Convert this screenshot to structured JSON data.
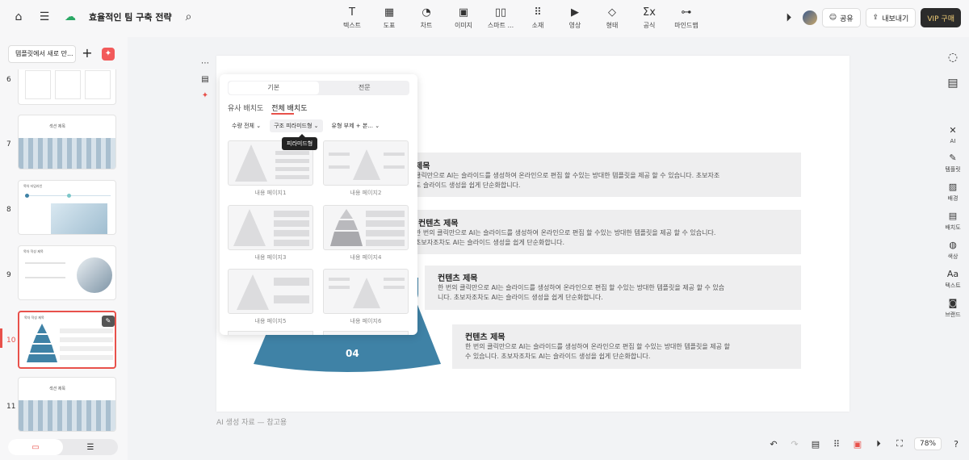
{
  "header": {
    "doc_title": "효율적인 팀 구축 전략",
    "tools": [
      {
        "icon": "text-icon",
        "glyph": "T",
        "label": "텍스트"
      },
      {
        "icon": "table-icon",
        "glyph": "▦",
        "label": "도표"
      },
      {
        "icon": "chart-icon",
        "glyph": "◔",
        "label": "차트"
      },
      {
        "icon": "image-icon",
        "glyph": "▣",
        "label": "이미지"
      },
      {
        "icon": "smart-icon",
        "glyph": "▯▯",
        "label": "스마트 ..."
      },
      {
        "icon": "elements-icon",
        "glyph": "⠿",
        "label": "소재"
      },
      {
        "icon": "video-icon",
        "glyph": "▶",
        "label": "영상"
      },
      {
        "icon": "shape-icon",
        "glyph": "◇",
        "label": "형태"
      },
      {
        "icon": "formula-icon",
        "glyph": "Σx",
        "label": "공식"
      },
      {
        "icon": "mindmap-icon",
        "glyph": "⊶",
        "label": "마인드맵"
      }
    ],
    "share_label": "공유",
    "export_label": "내보내기",
    "vip_label": "VIP 구매"
  },
  "sidebar": {
    "template_btn": "템플릿에서 새로 만...",
    "thumbnails": [
      {
        "num": "6"
      },
      {
        "num": "7",
        "title": "섹션 제목"
      },
      {
        "num": "8",
        "title": "목차 타임라인"
      },
      {
        "num": "9",
        "title": "목차 작성 제목"
      },
      {
        "num": "10",
        "title": "목차 작성 제목"
      },
      {
        "num": "11",
        "title": "섹션 제목"
      }
    ]
  },
  "slide": {
    "rows": [
      {
        "title": "제목",
        "text": "클릭만으로 AI는 슬라이드를 생성하여 온라인으로 편집 할 수있는 방대한 템플릿을 제공 할 수 있습니다. 초보자조\n도 슬라이드 생성을 쉽게 단순화합니다."
      },
      {
        "title": "컨텐츠 제목",
        "text": "한 번의 클릭만으로 AI는 슬라이드를 생성하여 온라인으로 편집 할 수있는 방대한 템플릿을 제공 할 수 있습니다.\n초보자조차도 AI는 슬라이드 생성을 쉽게 단순화합니다."
      },
      {
        "title": "컨텐츠 제목",
        "text": "한 번의 클릭만으로 AI는 슬라이드를 생성하여 온라인으로 편집 할 수있는 방대한 템플릿을 제공 할 수 있습\n니다. 초보자조차도 AI는 슬라이드 생성을 쉽게 단순화합니다."
      },
      {
        "title": "컨텐츠 제목",
        "text": "한 번의 클릭만으로 AI는 슬라이드를 생성하여 온라인으로 편집 할 수있는 방대한 템플릿을 제공 할\n수 있습니다. 초보자조차도 AI는 슬라이드 생성을 쉽게 단순화합니다."
      }
    ],
    "pyramid_label": "04",
    "caption": "AI 생성 자료 — 참고용"
  },
  "panel": {
    "seg_basic": "기본",
    "seg_pro": "전문",
    "subtab_similar": "유사 배치도",
    "subtab_all": "전체 배치도",
    "filter_count": "수량 전체",
    "filter_structure": "구조 피라미드형",
    "filter_type": "유형 부제 + 본...",
    "tooltip": "피라미드형",
    "layouts": [
      "내용 페이지1",
      "내용 페이지2",
      "내용 페이지3",
      "내용 페이지4",
      "내용 페이지5",
      "내용 페이지6"
    ]
  },
  "right_rail": [
    {
      "icon": "ai-icon",
      "glyph": "✕",
      "label": "AI"
    },
    {
      "icon": "template-icon",
      "glyph": "✎",
      "label": "템플릿"
    },
    {
      "icon": "background-icon",
      "glyph": "▨",
      "label": "배경"
    },
    {
      "icon": "layout-icon",
      "glyph": "▤",
      "label": "배치도"
    },
    {
      "icon": "palette-icon",
      "glyph": "◍",
      "label": "색상"
    },
    {
      "icon": "font-icon",
      "glyph": "Aa",
      "label": "텍스트"
    },
    {
      "icon": "brand-icon",
      "glyph": "◙",
      "label": "브랜드"
    }
  ],
  "footer": {
    "zoom": "78%"
  },
  "colors": {
    "accent": "#e8514b",
    "pyramid": "#3f82a6"
  }
}
